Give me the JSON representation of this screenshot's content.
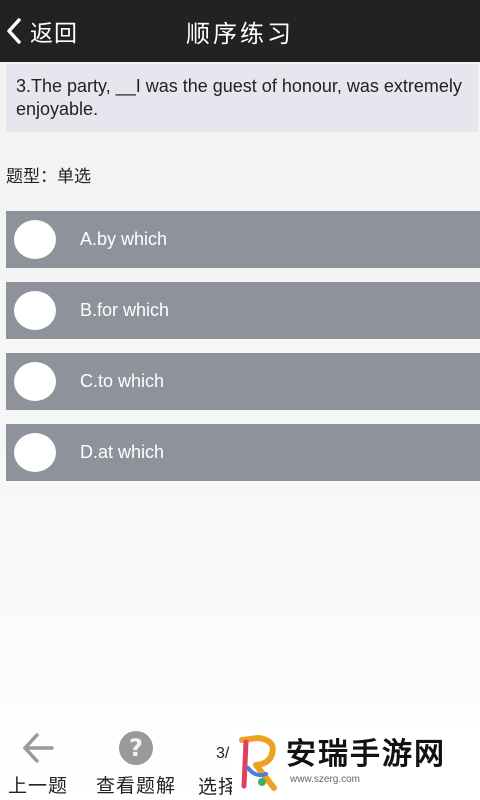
{
  "header": {
    "back_label": "返回",
    "title": "顺序练习"
  },
  "question": {
    "text": "3.The party, __I was the guest of honour, was extremely enjoyable.",
    "type_label": "题型：单选"
  },
  "options": [
    {
      "label": "A.by which"
    },
    {
      "label": "B.for which"
    },
    {
      "label": "C.to which"
    },
    {
      "label": "D.at which"
    }
  ],
  "footer": {
    "prev_label": "上一题",
    "explain_label": "查看题解",
    "counter": "3/",
    "select_label": "选择"
  },
  "watermark": {
    "text": "安瑞手游网",
    "url": "www.szerg.com"
  },
  "colors": {
    "header_bg": "#222222",
    "question_bg": "#e6e6ee",
    "option_bg": "#8e939b",
    "icon_gray": "#999999"
  }
}
